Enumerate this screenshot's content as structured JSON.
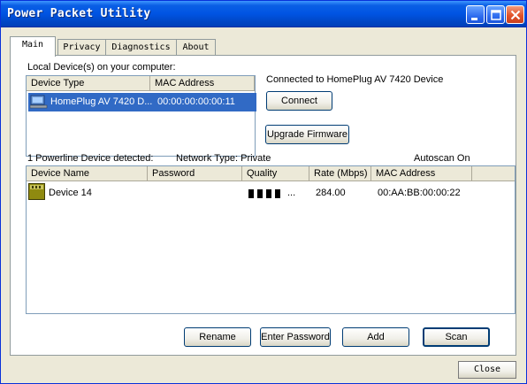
{
  "window": {
    "title": "Power Packet Utility"
  },
  "tabs": [
    {
      "label": "Main"
    },
    {
      "label": "Privacy"
    },
    {
      "label": "Diagnostics"
    },
    {
      "label": "About"
    }
  ],
  "local": {
    "heading": "Local Device(s) on your computer:",
    "columns": [
      "Device Type",
      "MAC Address"
    ],
    "rows": [
      {
        "device_type": "HomePlug AV 7420 D...",
        "mac": "00:00:00:00:00:11",
        "selected": true
      }
    ]
  },
  "connection": {
    "status": "Connected to HomePlug AV 7420 Device",
    "connect_label": "Connect",
    "upgrade_label": "Upgrade Firmware"
  },
  "summary": {
    "detected": "1 Powerline Device detected:",
    "network_type": "Network Type: Private",
    "autoscan": "Autoscan On"
  },
  "remote": {
    "columns": [
      "Device Name",
      "Password",
      "Quality",
      "Rate (Mbps)",
      "MAC Address"
    ],
    "rows": [
      {
        "name": "Device 14",
        "password": "",
        "quality_bars": 4,
        "quality_suffix": "...",
        "rate": "284.00",
        "mac": "00:AA:BB:00:00:22"
      }
    ]
  },
  "actions": {
    "rename": "Rename",
    "enter_password": "Enter Password",
    "add": "Add",
    "scan": "Scan"
  },
  "footer": {
    "close": "Close"
  },
  "colors": {
    "titlebar": "#0054e3",
    "selection": "#316ac5",
    "face": "#ece9d8"
  }
}
